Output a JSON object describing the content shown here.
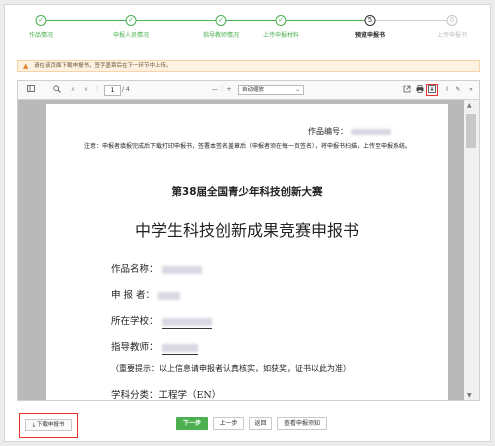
{
  "stepper": {
    "steps": [
      {
        "label": "作品情况",
        "marker": "✓",
        "state": "done"
      },
      {
        "label": "申报人员情况",
        "marker": "✓",
        "state": "done"
      },
      {
        "label": "指导教师情况",
        "marker": "✓",
        "state": "done"
      },
      {
        "label": "上传申报材料",
        "marker": "✓",
        "state": "done"
      },
      {
        "label": "预览申报书",
        "marker": "5",
        "state": "current"
      },
      {
        "label": "上传申报书",
        "marker": "6",
        "state": "future"
      }
    ]
  },
  "notice": {
    "text": "请在该页面下载申报书，签字盖章后在下一环节中上传。",
    "icon": "warning-icon"
  },
  "viewer": {
    "current_page": "1",
    "total_pages": "/ 4",
    "zoom": "自动缩放",
    "icons": [
      "sidebar-toggle-icon",
      "search-icon",
      "previous-page-icon",
      "next-page-icon",
      "zoom-out-icon",
      "zoom-in-icon",
      "open-file-icon",
      "print-icon",
      "save-icon",
      "text-select-icon",
      "draw-icon",
      "more-tools-icon"
    ]
  },
  "document": {
    "serial_label": "作品编号：",
    "note": "注意：申报者填报完成后下载打印申报书，签署本签名盖章后（申报者须在每一页签名），将申报书扫描，上传至申报系统。",
    "contest_title": "第38届全国青少年科技创新大赛",
    "form_title": "中学生科技创新成果竞赛申报书",
    "fields": [
      {
        "label": "作品名称："
      },
      {
        "label": "申 报 者："
      },
      {
        "label": "所在学校："
      },
      {
        "label": "指导教师："
      }
    ],
    "reminder": "（重要提示：以上信息请申报者认真核实，如获奖，证书以此为准）",
    "subject": "学科分类：工程学（EN）"
  },
  "actions": {
    "download": "下载申报书",
    "next": "下一步",
    "prev": "上一步",
    "back": "返回",
    "view_notice": "查看申报须知"
  },
  "colors": {
    "accent": "#4caf50",
    "highlight": "#e5322d",
    "notice_bg": "#fdf1e2"
  }
}
